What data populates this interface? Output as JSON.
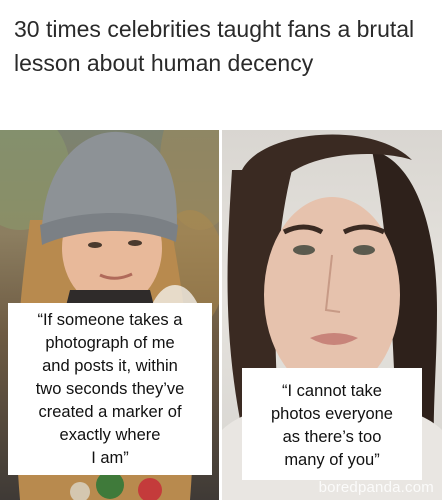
{
  "headline": "30 times celebrities taught fans a brutal lesson about human decency",
  "panels": [
    {
      "quote": "“If someone takes a\nphotograph of me\nand posts it, within\ntwo seconds they’ve\ncreated a marker of\nexactly where\nI am”"
    },
    {
      "quote": "“I cannot take\nphotos everyone\nas there’s too\nmany of you”"
    }
  ],
  "watermark": "boredpanda.com"
}
